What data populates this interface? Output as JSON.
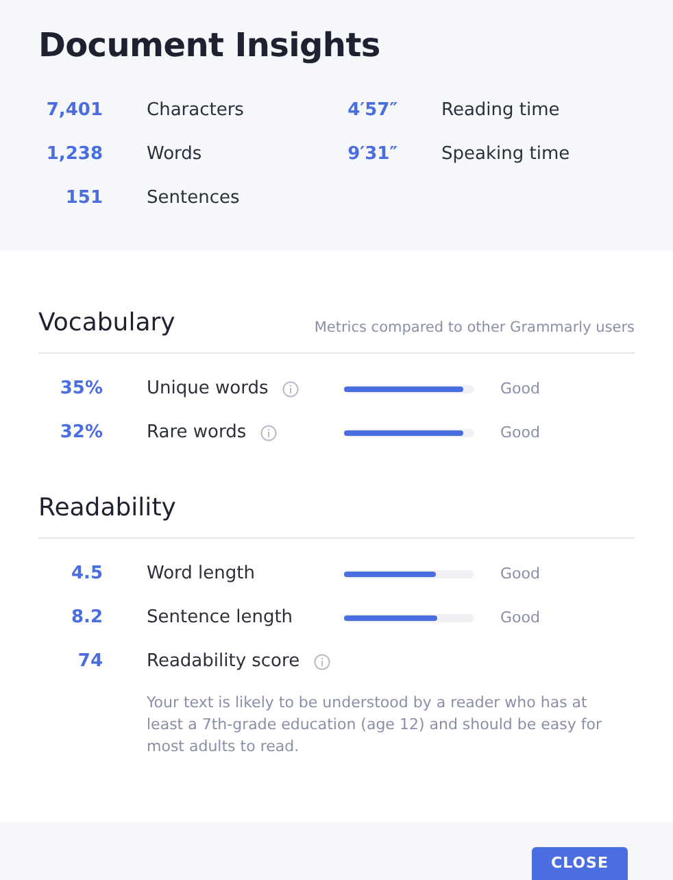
{
  "title": "Document Insights",
  "stats": [
    {
      "value": "7,401",
      "label": "Characters"
    },
    {
      "value": "4′57″",
      "label": "Reading time"
    },
    {
      "value": "1,238",
      "label": "Words"
    },
    {
      "value": "9′31″",
      "label": "Speaking time"
    },
    {
      "value": "151",
      "label": "Sentences"
    }
  ],
  "sections": [
    {
      "title": "Vocabulary",
      "hint": "Metrics compared to other Grammarly users",
      "metrics": [
        {
          "kind": "bar",
          "value": "35%",
          "label": "Unique words",
          "info": true,
          "level": 0.92,
          "rating": "Good"
        },
        {
          "kind": "bar",
          "value": "32%",
          "label": "Rare words",
          "info": true,
          "level": 0.92,
          "rating": "Good"
        }
      ]
    },
    {
      "title": "Readability",
      "metrics": [
        {
          "kind": "bar",
          "value": "4.5",
          "label": "Word length",
          "info": false,
          "level": 0.7,
          "rating": "Good"
        },
        {
          "kind": "bar",
          "value": "8.2",
          "label": "Sentence length",
          "info": false,
          "level": 0.72,
          "rating": "Good"
        },
        {
          "kind": "score",
          "value": "74",
          "label": "Readability score",
          "info": true,
          "note": "Your text is likely to be understood by a reader who has at least a 7th-grade education (age 12) and should be easy for most adults to read."
        }
      ]
    }
  ],
  "footer": {
    "button": "CLOSE"
  }
}
